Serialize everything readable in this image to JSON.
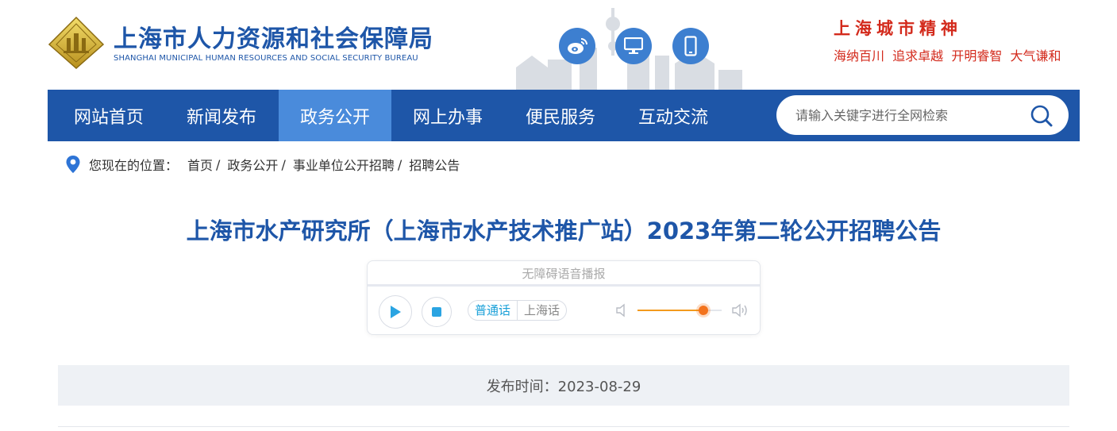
{
  "header": {
    "org_name_cn": "上海市人力资源和社会保障局",
    "org_name_en": "SHANGHAI MUNICIPAL HUMAN RESOURCES AND SOCIAL SECURITY BUREAU",
    "social_icons": [
      "weibo-icon",
      "desktop-icon",
      "mobile-icon"
    ],
    "spirit_title": "上海城市精神",
    "spirit_slogan": "海纳百川  追求卓越  开明睿智  大气谦和"
  },
  "nav": {
    "items": [
      {
        "label": "网站首页",
        "active": false
      },
      {
        "label": "新闻发布",
        "active": false
      },
      {
        "label": "政务公开",
        "active": true
      },
      {
        "label": "网上办事",
        "active": false
      },
      {
        "label": "便民服务",
        "active": false
      },
      {
        "label": "互动交流",
        "active": false
      }
    ],
    "search_placeholder": "请输入关键字进行全网检索",
    "search_value": ""
  },
  "breadcrumb": {
    "label": "您现在的位置：",
    "items": [
      "首页",
      "政务公开",
      "事业单位公开招聘",
      "招聘公告"
    ],
    "separator": "/"
  },
  "article": {
    "title": "上海市水产研究所（上海市水产技术推广站）2023年第二轮公开招聘公告",
    "publish_time": "发布时间：2023-08-29"
  },
  "player": {
    "title": "无障碍语音播报",
    "languages": [
      {
        "label": "普通话",
        "active": true
      },
      {
        "label": "上海话",
        "active": false
      }
    ],
    "volume_level": 0.78
  },
  "colors": {
    "brand_blue": "#1e56a8",
    "nav_active": "#4a8bdb",
    "spirit_red": "#d32a1c",
    "volume_orange": "#f3731d"
  }
}
